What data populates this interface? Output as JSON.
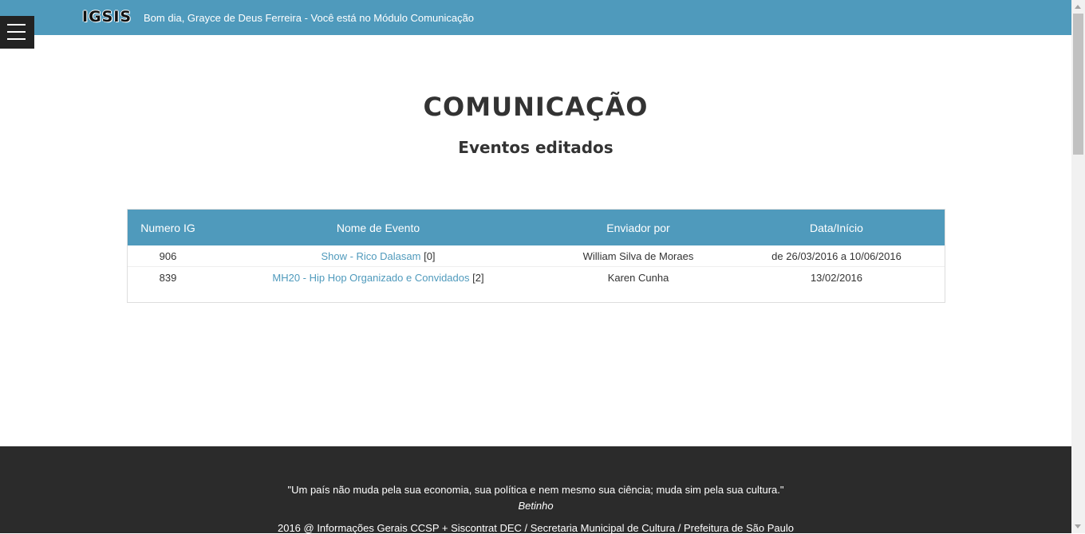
{
  "header": {
    "logo": "IGSIS",
    "greeting": "Bom dia, Grayce de Deus Ferreira - Você está no Módulo Comunicação"
  },
  "menu": {
    "icon": "hamburger-menu-icon"
  },
  "main": {
    "title": "COMUNICAÇÃO",
    "subtitle": "Eventos editados"
  },
  "table": {
    "columns": [
      "Numero IG",
      "Nome de Evento",
      "Enviador por",
      "Data/Início"
    ],
    "rows": [
      {
        "numero": "906",
        "nome": "Show - Rico Dalasam",
        "count": "[0]",
        "enviador": "William Silva de Moraes",
        "data": "de 26/03/2016 a 10/06/2016"
      },
      {
        "numero": "839",
        "nome": "MH20 - Hip Hop Organizado e Convidados",
        "count": "[2]",
        "enviador": "Karen Cunha",
        "data": "13/02/2016"
      }
    ]
  },
  "footer": {
    "quote": "\"Um país não muda pela sua economia, sua política e nem mesmo sua ciência; muda sim pela sua cultura.\"",
    "author": "Betinho",
    "credits": "2016 @ Informações Gerais CCSP + Siscontrat DEC / Secretaria Municipal de Cultura / Prefeitura de São Paulo"
  },
  "colors": {
    "header_bg": "#4f9abc",
    "link": "#4f9abc",
    "footer_bg": "#2b2b2b",
    "menu_bg": "#222222"
  }
}
